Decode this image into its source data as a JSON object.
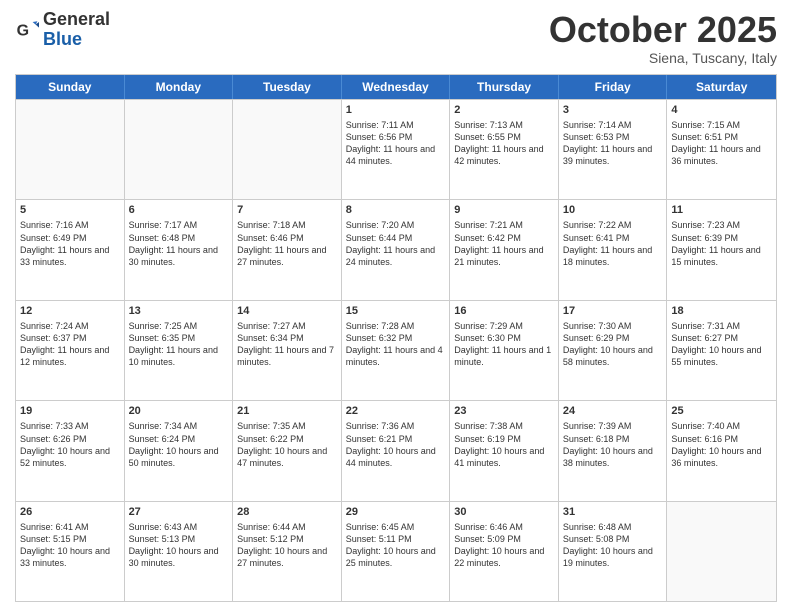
{
  "logo": {
    "general": "General",
    "blue": "Blue"
  },
  "header": {
    "month": "October 2025",
    "location": "Siena, Tuscany, Italy"
  },
  "weekdays": [
    "Sunday",
    "Monday",
    "Tuesday",
    "Wednesday",
    "Thursday",
    "Friday",
    "Saturday"
  ],
  "rows": [
    [
      {
        "day": "",
        "info": ""
      },
      {
        "day": "",
        "info": ""
      },
      {
        "day": "",
        "info": ""
      },
      {
        "day": "1",
        "info": "Sunrise: 7:11 AM\nSunset: 6:56 PM\nDaylight: 11 hours and 44 minutes."
      },
      {
        "day": "2",
        "info": "Sunrise: 7:13 AM\nSunset: 6:55 PM\nDaylight: 11 hours and 42 minutes."
      },
      {
        "day": "3",
        "info": "Sunrise: 7:14 AM\nSunset: 6:53 PM\nDaylight: 11 hours and 39 minutes."
      },
      {
        "day": "4",
        "info": "Sunrise: 7:15 AM\nSunset: 6:51 PM\nDaylight: 11 hours and 36 minutes."
      }
    ],
    [
      {
        "day": "5",
        "info": "Sunrise: 7:16 AM\nSunset: 6:49 PM\nDaylight: 11 hours and 33 minutes."
      },
      {
        "day": "6",
        "info": "Sunrise: 7:17 AM\nSunset: 6:48 PM\nDaylight: 11 hours and 30 minutes."
      },
      {
        "day": "7",
        "info": "Sunrise: 7:18 AM\nSunset: 6:46 PM\nDaylight: 11 hours and 27 minutes."
      },
      {
        "day": "8",
        "info": "Sunrise: 7:20 AM\nSunset: 6:44 PM\nDaylight: 11 hours and 24 minutes."
      },
      {
        "day": "9",
        "info": "Sunrise: 7:21 AM\nSunset: 6:42 PM\nDaylight: 11 hours and 21 minutes."
      },
      {
        "day": "10",
        "info": "Sunrise: 7:22 AM\nSunset: 6:41 PM\nDaylight: 11 hours and 18 minutes."
      },
      {
        "day": "11",
        "info": "Sunrise: 7:23 AM\nSunset: 6:39 PM\nDaylight: 11 hours and 15 minutes."
      }
    ],
    [
      {
        "day": "12",
        "info": "Sunrise: 7:24 AM\nSunset: 6:37 PM\nDaylight: 11 hours and 12 minutes."
      },
      {
        "day": "13",
        "info": "Sunrise: 7:25 AM\nSunset: 6:35 PM\nDaylight: 11 hours and 10 minutes."
      },
      {
        "day": "14",
        "info": "Sunrise: 7:27 AM\nSunset: 6:34 PM\nDaylight: 11 hours and 7 minutes."
      },
      {
        "day": "15",
        "info": "Sunrise: 7:28 AM\nSunset: 6:32 PM\nDaylight: 11 hours and 4 minutes."
      },
      {
        "day": "16",
        "info": "Sunrise: 7:29 AM\nSunset: 6:30 PM\nDaylight: 11 hours and 1 minute."
      },
      {
        "day": "17",
        "info": "Sunrise: 7:30 AM\nSunset: 6:29 PM\nDaylight: 10 hours and 58 minutes."
      },
      {
        "day": "18",
        "info": "Sunrise: 7:31 AM\nSunset: 6:27 PM\nDaylight: 10 hours and 55 minutes."
      }
    ],
    [
      {
        "day": "19",
        "info": "Sunrise: 7:33 AM\nSunset: 6:26 PM\nDaylight: 10 hours and 52 minutes."
      },
      {
        "day": "20",
        "info": "Sunrise: 7:34 AM\nSunset: 6:24 PM\nDaylight: 10 hours and 50 minutes."
      },
      {
        "day": "21",
        "info": "Sunrise: 7:35 AM\nSunset: 6:22 PM\nDaylight: 10 hours and 47 minutes."
      },
      {
        "day": "22",
        "info": "Sunrise: 7:36 AM\nSunset: 6:21 PM\nDaylight: 10 hours and 44 minutes."
      },
      {
        "day": "23",
        "info": "Sunrise: 7:38 AM\nSunset: 6:19 PM\nDaylight: 10 hours and 41 minutes."
      },
      {
        "day": "24",
        "info": "Sunrise: 7:39 AM\nSunset: 6:18 PM\nDaylight: 10 hours and 38 minutes."
      },
      {
        "day": "25",
        "info": "Sunrise: 7:40 AM\nSunset: 6:16 PM\nDaylight: 10 hours and 36 minutes."
      }
    ],
    [
      {
        "day": "26",
        "info": "Sunrise: 6:41 AM\nSunset: 5:15 PM\nDaylight: 10 hours and 33 minutes."
      },
      {
        "day": "27",
        "info": "Sunrise: 6:43 AM\nSunset: 5:13 PM\nDaylight: 10 hours and 30 minutes."
      },
      {
        "day": "28",
        "info": "Sunrise: 6:44 AM\nSunset: 5:12 PM\nDaylight: 10 hours and 27 minutes."
      },
      {
        "day": "29",
        "info": "Sunrise: 6:45 AM\nSunset: 5:11 PM\nDaylight: 10 hours and 25 minutes."
      },
      {
        "day": "30",
        "info": "Sunrise: 6:46 AM\nSunset: 5:09 PM\nDaylight: 10 hours and 22 minutes."
      },
      {
        "day": "31",
        "info": "Sunrise: 6:48 AM\nSunset: 5:08 PM\nDaylight: 10 hours and 19 minutes."
      },
      {
        "day": "",
        "info": ""
      }
    ]
  ]
}
